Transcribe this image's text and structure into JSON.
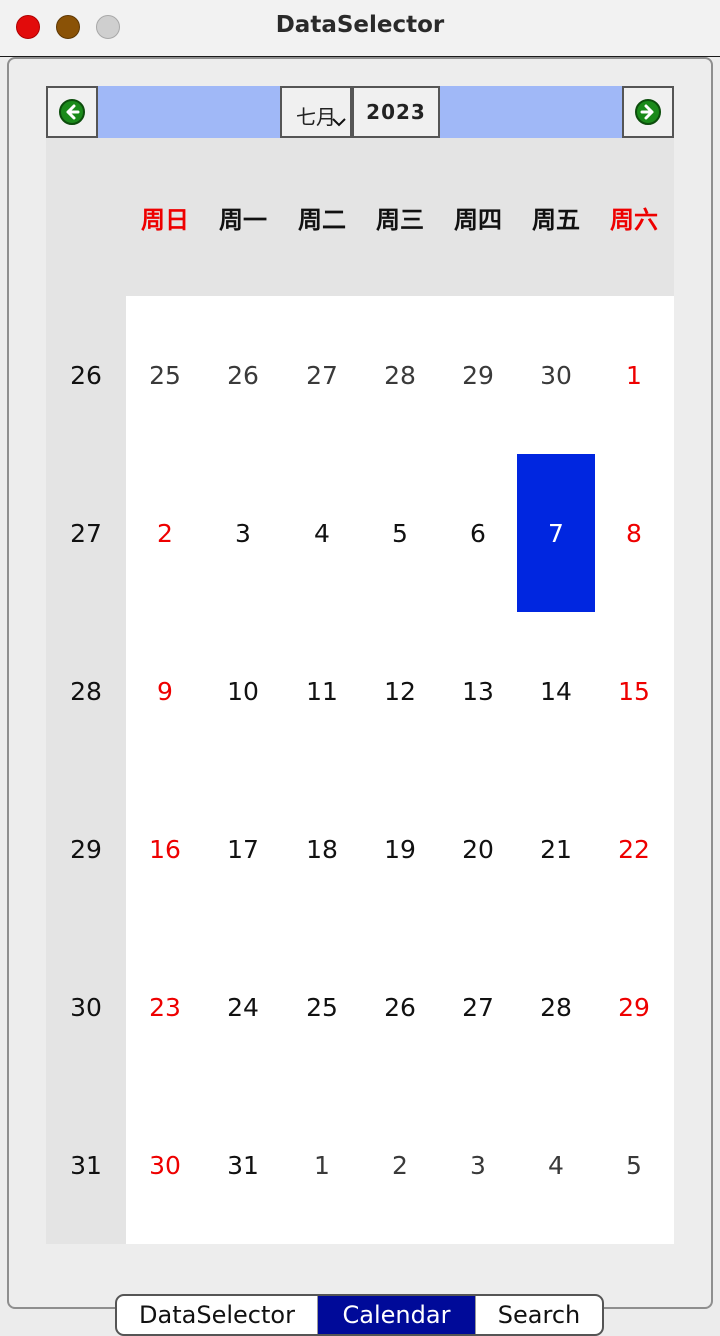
{
  "window": {
    "title": "DataSelector"
  },
  "nav": {
    "prev_icon": "left-arrow-icon",
    "next_icon": "right-arrow-icon",
    "month": "七月",
    "year": "2023",
    "accent_color": "#a0b8f7"
  },
  "calendar": {
    "weekdays": [
      "周日",
      "周一",
      "周二",
      "周三",
      "周四",
      "周五",
      "周六"
    ],
    "weeks": [
      {
        "number": "26",
        "days": [
          {
            "label": "25",
            "other": true
          },
          {
            "label": "26",
            "other": true
          },
          {
            "label": "27",
            "other": true
          },
          {
            "label": "28",
            "other": true
          },
          {
            "label": "29",
            "other": true
          },
          {
            "label": "30",
            "other": true
          },
          {
            "label": "1"
          }
        ]
      },
      {
        "number": "27",
        "days": [
          {
            "label": "2"
          },
          {
            "label": "3"
          },
          {
            "label": "4"
          },
          {
            "label": "5"
          },
          {
            "label": "6"
          },
          {
            "label": "7",
            "selected": true
          },
          {
            "label": "8"
          }
        ]
      },
      {
        "number": "28",
        "days": [
          {
            "label": "9"
          },
          {
            "label": "10"
          },
          {
            "label": "11"
          },
          {
            "label": "12"
          },
          {
            "label": "13"
          },
          {
            "label": "14"
          },
          {
            "label": "15"
          }
        ]
      },
      {
        "number": "29",
        "days": [
          {
            "label": "16"
          },
          {
            "label": "17"
          },
          {
            "label": "18"
          },
          {
            "label": "19"
          },
          {
            "label": "20"
          },
          {
            "label": "21"
          },
          {
            "label": "22"
          }
        ]
      },
      {
        "number": "30",
        "days": [
          {
            "label": "23"
          },
          {
            "label": "24"
          },
          {
            "label": "25"
          },
          {
            "label": "26"
          },
          {
            "label": "27"
          },
          {
            "label": "28"
          },
          {
            "label": "29"
          }
        ]
      },
      {
        "number": "31",
        "days": [
          {
            "label": "30"
          },
          {
            "label": "31"
          },
          {
            "label": "1",
            "other": true
          },
          {
            "label": "2",
            "other": true
          },
          {
            "label": "3",
            "other": true
          },
          {
            "label": "4",
            "other": true
          },
          {
            "label": "5",
            "other": true
          }
        ]
      }
    ],
    "weekend_color": "#ee0000",
    "selected_color": "#0026e0"
  },
  "tabs": [
    {
      "label": "DataSelector",
      "active": false
    },
    {
      "label": "Calendar",
      "active": true
    },
    {
      "label": "Search",
      "active": false
    }
  ]
}
